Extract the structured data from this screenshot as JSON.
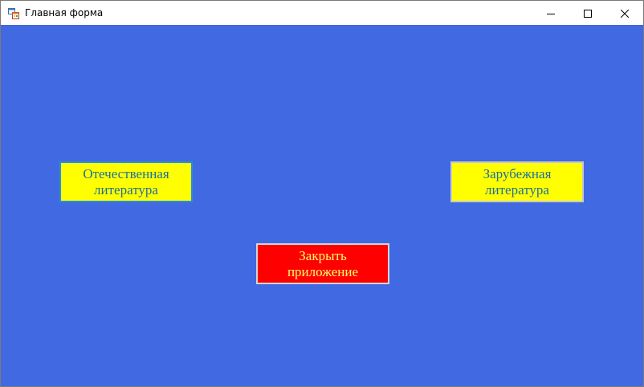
{
  "window": {
    "title": "Главная форма",
    "icon": "form-app-icon",
    "controls": {
      "minimize_icon": "minimize-icon",
      "maximize_icon": "maximize-icon",
      "close_icon": "close-icon"
    }
  },
  "form": {
    "background_color": "#4169e1",
    "buttons": {
      "domestic_label": "Отечественная\nлитература",
      "foreign_label": "Зарубежная\nлитература",
      "close_label": "Закрыть\nприложение"
    },
    "colors": {
      "literature_button_bg": "#ffff00",
      "literature_button_text": "#1f6f9a",
      "close_button_bg": "#ff0000",
      "close_button_text": "#ffff66"
    }
  }
}
